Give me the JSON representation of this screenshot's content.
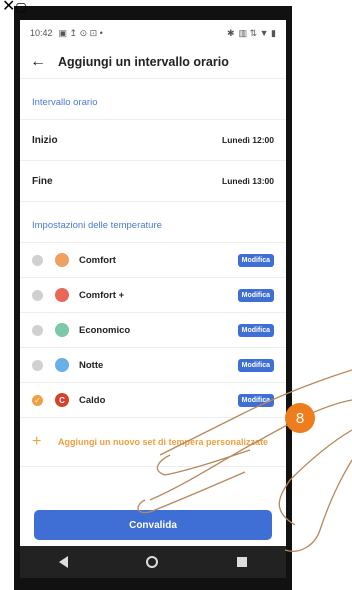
{
  "status_bar": {
    "time": "10:42"
  },
  "header": {
    "title": "Aggiungi un intervallo orario"
  },
  "interval_section": {
    "title": "Intervallo orario",
    "rows": [
      {
        "label": "Inizio",
        "value": "Lunedì 12:00"
      },
      {
        "label": "Fine",
        "value": "Lunedì 13:00"
      }
    ]
  },
  "temp_section": {
    "title": "Impostazioni delle temperature",
    "items": [
      {
        "name": "Comfort",
        "color": "#f0a060",
        "selected": false
      },
      {
        "name": "Comfort +",
        "color": "#e86858",
        "selected": false
      },
      {
        "name": "Economico",
        "color": "#7cc8a8",
        "selected": false
      },
      {
        "name": "Notte",
        "color": "#6ab0e8",
        "selected": false
      },
      {
        "name": "Caldo",
        "color": "#d8402a",
        "selected": true
      }
    ],
    "modify_label": "Modifica",
    "add_label": "Aggiungi un nuovo set di tempera personalizzate"
  },
  "confirm_label": "Convalida",
  "step_number": "8",
  "colors": {
    "accent": "#3f6fd4",
    "orange": "#f0a040"
  }
}
